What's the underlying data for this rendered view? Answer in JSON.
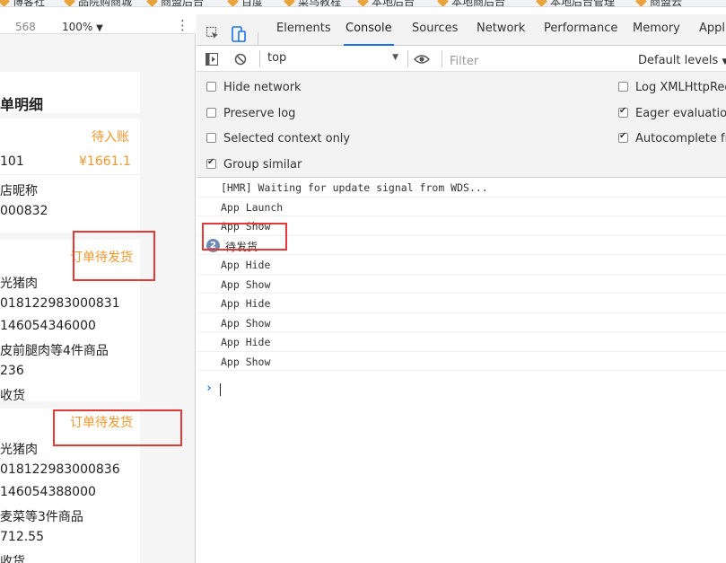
{
  "bookmarks": [
    "博客社",
    "品院购商城",
    "商盟后台",
    "百度",
    "菜鸟教程",
    "本地后台",
    "本地商后台",
    "本地后台管理",
    "商盟云"
  ],
  "device_bar": {
    "height_value": "568",
    "zoom": "100%",
    "zoom_caret": "▼",
    "more_icon": "⋮"
  },
  "preview": {
    "title": "单明细",
    "status_pending_account": "待入账",
    "order_id_partial": "101",
    "amount": "¥1661.1",
    "shop_nickname": "店昵称",
    "shop_id": "000832",
    "orders": [
      {
        "status": "订单待发货",
        "name": "光猪肉",
        "order_no": "018122983000831",
        "phone": "146054346000",
        "goods": "皮前腿肉等4件商品",
        "price": "236",
        "receive": "收货"
      },
      {
        "status": "订单待发货",
        "name": "光猪肉",
        "order_no": "018122983000836",
        "phone": "146054388000",
        "goods": "麦菜等3件商品",
        "price": "712.55",
        "receive": "收货"
      }
    ]
  },
  "devtools": {
    "tabs": [
      "Elements",
      "Console",
      "Sources",
      "Network",
      "Performance",
      "Memory",
      "Appli"
    ],
    "active_tab": "Console",
    "context": "top",
    "filter_placeholder": "Filter",
    "levels": "Default levels",
    "levels_caret": "▼",
    "settings_left": [
      {
        "label": "Hide network",
        "checked": false
      },
      {
        "label": "Preserve log",
        "checked": false
      },
      {
        "label": "Selected context only",
        "checked": false
      },
      {
        "label": "Group similar",
        "checked": true
      }
    ],
    "settings_right": [
      {
        "label": "Log XMLHttpRequ",
        "checked": false
      },
      {
        "label": "Eager evaluation",
        "checked": true
      },
      {
        "label": "Autocomplete fro",
        "checked": true
      }
    ],
    "log": [
      {
        "text": "[HMR] Waiting for update signal from WDS...",
        "count": ""
      },
      {
        "text": "App Launch",
        "count": ""
      },
      {
        "text": "App Show",
        "count": ""
      },
      {
        "text": "待发货",
        "count": "2"
      },
      {
        "text": "App Hide",
        "count": ""
      },
      {
        "text": "App Show",
        "count": ""
      },
      {
        "text": "App Hide",
        "count": ""
      },
      {
        "text": "App Show",
        "count": ""
      },
      {
        "text": "App Hide",
        "count": ""
      },
      {
        "text": "App Show",
        "count": ""
      }
    ],
    "prompt_chevron": "›"
  },
  "colors": {
    "accent_blue": "#1a73e8",
    "orange_status": "#f0962e",
    "highlight_red": "#e53935",
    "badge": "#6e8ab3"
  }
}
